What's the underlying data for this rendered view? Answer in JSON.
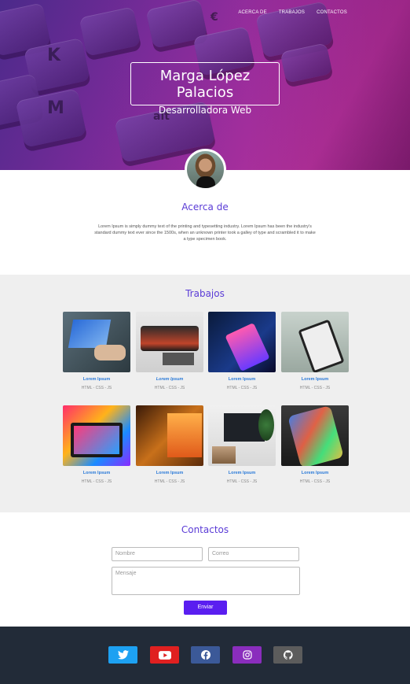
{
  "nav": {
    "items": [
      {
        "label": "ACERCA DE"
      },
      {
        "label": "TRABAJOS"
      },
      {
        "label": "CONTACTOS"
      }
    ]
  },
  "hero": {
    "name": "Marga López Palacios",
    "role": "Desarrolladora Web"
  },
  "about": {
    "title": "Acerca de",
    "text": "Lorem Ipsum is simply dummy text of the printing and typesetting industry. Lorem Ipsum has been the industry's standard dummy text ever since the 1500s, when an unknown printer took a galley of type and scrambled it to make a type specimen book."
  },
  "works": {
    "title": "Trabajos",
    "items": [
      {
        "title": "Lorem Ipsum",
        "tech": "HTML - CSS - JS"
      },
      {
        "title": "Lorem Ipsum",
        "tech": "HTML - CSS - JS"
      },
      {
        "title": "Lorem Ipsum",
        "tech": "HTML - CSS - JS"
      },
      {
        "title": "Lorem Ipsum",
        "tech": "HTML - CSS - JS"
      },
      {
        "title": "Lorem Ipsum",
        "tech": "HTML - CSS - JS"
      },
      {
        "title": "Lorem Ipsum",
        "tech": "HTML - CSS - JS"
      },
      {
        "title": "Lorem Ipsum",
        "tech": "HTML - CSS - JS"
      },
      {
        "title": "Lorem Ipsum",
        "tech": "HTML - CSS - JS"
      }
    ]
  },
  "contact": {
    "title": "Contactos",
    "name_placeholder": "Nombre",
    "email_placeholder": "Correo",
    "message_placeholder": "Mensaje",
    "send_label": "Enviar"
  },
  "social": [
    {
      "icon": "twitter-icon",
      "color": "#1da1f2"
    },
    {
      "icon": "youtube-icon",
      "color": "#e02020"
    },
    {
      "icon": "facebook-icon",
      "color": "#3b5998"
    },
    {
      "icon": "instagram-icon",
      "color": "#8a2dbd"
    },
    {
      "icon": "github-icon",
      "color": "#5c5c5c"
    }
  ],
  "colors": {
    "accent": "#5a3bd6",
    "link": "#2a7ad8",
    "button": "#5a1ef0",
    "footer": "#222b38"
  }
}
